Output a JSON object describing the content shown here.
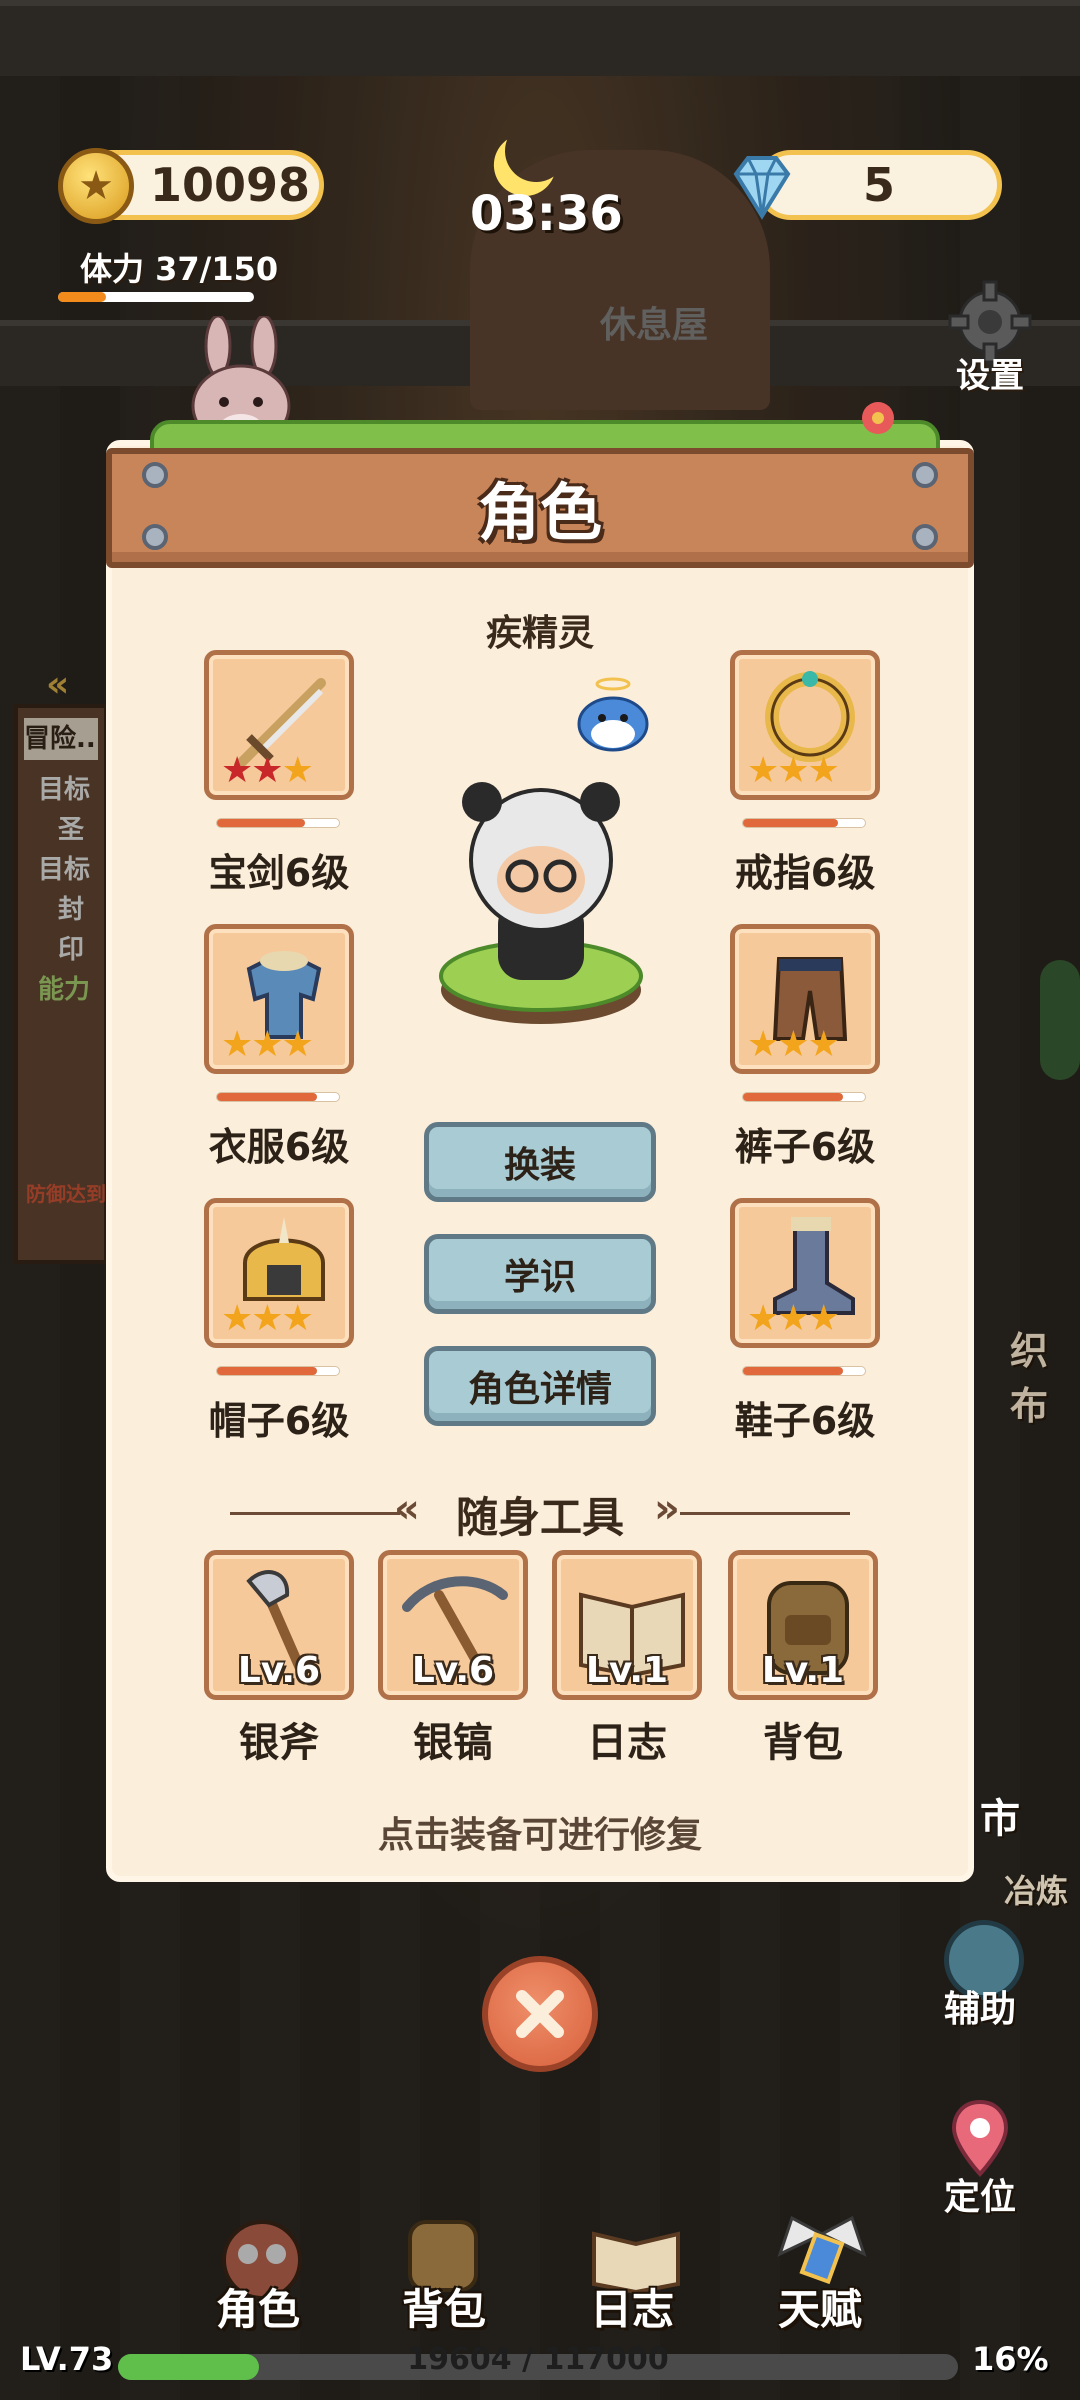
{
  "hud": {
    "coins": "10098",
    "stamina": "体力 37/150",
    "stamina_fraction": 0.247,
    "time": "03:36",
    "gems": "5",
    "house_label": "休息屋",
    "settings_label": "设置"
  },
  "left_quest": {
    "tab": "冒险...",
    "lines": [
      "目标",
      "圣",
      "目标",
      "封印",
      "能力"
    ],
    "note": "防御达到"
  },
  "panel": {
    "title": "角色",
    "spirit_name": "疾精灵",
    "equipment": [
      {
        "name": "宝剑6级",
        "icon": "sword-icon",
        "stars": 3,
        "red_stars": 2,
        "durability": 0.72
      },
      {
        "name": "戒指6级",
        "icon": "ring-icon",
        "stars": 3,
        "red_stars": 0,
        "durability": 0.78
      },
      {
        "name": "衣服6级",
        "icon": "clothes-icon",
        "stars": 3,
        "red_stars": 0,
        "durability": 0.82
      },
      {
        "name": "裤子6级",
        "icon": "pants-icon",
        "stars": 3,
        "red_stars": 0,
        "durability": 0.82
      },
      {
        "name": "帽子6级",
        "icon": "helmet-icon",
        "stars": 3,
        "red_stars": 0,
        "durability": 0.82
      },
      {
        "name": "鞋子6级",
        "icon": "boots-icon",
        "stars": 3,
        "red_stars": 0,
        "durability": 0.82
      }
    ],
    "buttons": {
      "change_outfit": "换装",
      "knowledge": "学识",
      "details": "角色详情"
    },
    "tools_title": "随身工具",
    "tools": [
      {
        "name": "银斧",
        "level": "Lv.6",
        "icon": "axe-icon"
      },
      {
        "name": "银镐",
        "level": "Lv.6",
        "icon": "pickaxe-icon"
      },
      {
        "name": "日志",
        "level": "Lv.1",
        "icon": "book-icon"
      },
      {
        "name": "背包",
        "level": "Lv.1",
        "icon": "backpack-icon"
      }
    ],
    "hint": "点击装备可进行修复"
  },
  "side": {
    "market": "市",
    "smelt": "冶炼",
    "assist": "辅助",
    "locate": "定位",
    "weave": "织布"
  },
  "nav": {
    "character": "角色",
    "bag": "背包",
    "journal": "日志",
    "talent": "天赋"
  },
  "status": {
    "level": "LV.73",
    "xp": "19604 / 117000",
    "percent": "16%",
    "xp_fraction": 0.1675
  },
  "colors": {
    "panel_bg": "#fbeedb",
    "plank": "#c9855a",
    "button": "#a9ccd4",
    "close": "#d8603c",
    "star": "#f2a41c",
    "star_red": "#c8282a"
  }
}
